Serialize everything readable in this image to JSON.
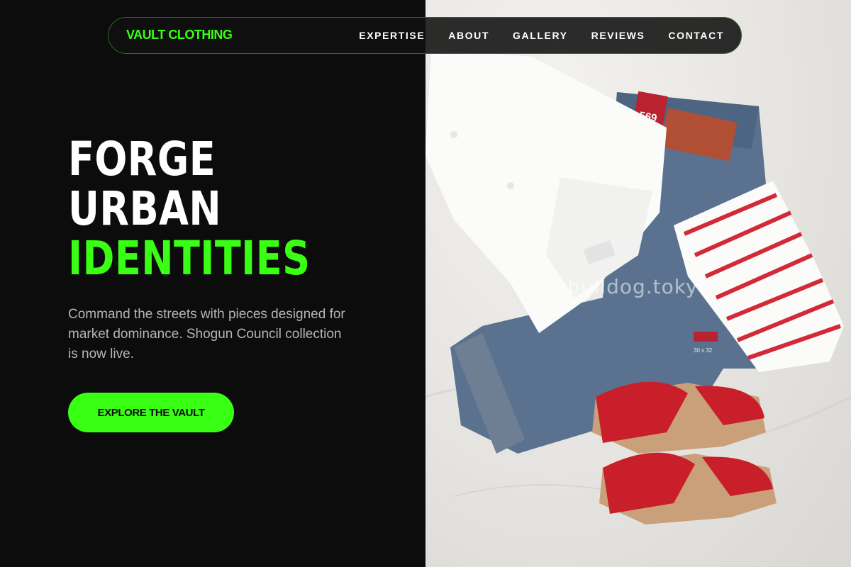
{
  "brand": {
    "name": "VAULT CLOTHING"
  },
  "nav": {
    "links": [
      {
        "label": "EXPERTISE"
      },
      {
        "label": "ABOUT"
      },
      {
        "label": "GALLERY"
      },
      {
        "label": "REVIEWS"
      },
      {
        "label": "CONTACT"
      }
    ]
  },
  "hero": {
    "headline": [
      "FORGE",
      "URBAN",
      "IDENTITIES"
    ],
    "subtitle": "Command the streets with pieces designed for market dominance. Shogun Council collection is now live.",
    "cta_label": "EXPLORE THE VAULT"
  },
  "photo": {
    "watermark": "bulldog.tokyo",
    "jeans_tag": "569",
    "jeans_label": "30 x 32"
  },
  "colors": {
    "accent": "#39ff14",
    "background": "#0c0c0c",
    "text": "#ffffff",
    "muted": "#b5b5b5"
  }
}
